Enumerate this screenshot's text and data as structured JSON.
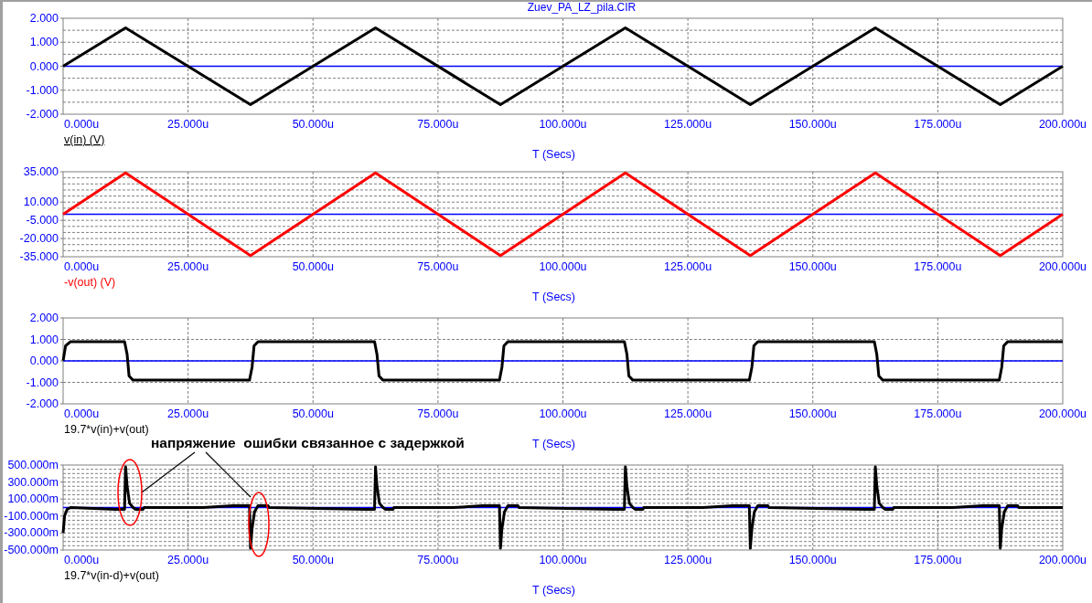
{
  "title": "Zuev_PA_LZ_pila.CIR",
  "charts": [
    {
      "legend_underlined": true,
      "chart_data": {
        "type": "line",
        "grid": true,
        "ref_lines": [
          {
            "axis": "y",
            "value": 0,
            "color": "#0000ff"
          }
        ],
        "xlabel": "T (Secs)",
        "xlim": [
          0,
          200
        ],
        "ylim": [
          -2,
          2
        ],
        "xticks": [
          {
            "value": 0,
            "label": "0.000u"
          },
          {
            "value": 25,
            "label": "25.000u"
          },
          {
            "value": 50,
            "label": "50.000u"
          },
          {
            "value": 75,
            "label": "75.000u"
          },
          {
            "value": 100,
            "label": "100.000u"
          },
          {
            "value": 125,
            "label": "125.000u"
          },
          {
            "value": 150,
            "label": "150.000u"
          },
          {
            "value": 175,
            "label": "175.000u"
          },
          {
            "value": 200,
            "label": "200.000u"
          }
        ],
        "yticks": [
          {
            "value": 2,
            "label": "2.000"
          },
          {
            "value": 1,
            "label": "1.000"
          },
          {
            "value": 0,
            "label": "0.000"
          },
          {
            "value": -1,
            "label": "-1.000"
          },
          {
            "value": -2,
            "label": "-2.000"
          }
        ],
        "x": [
          0,
          12.5,
          37.5,
          62.5,
          87.5,
          112.5,
          137.5,
          162.5,
          187.5,
          200
        ],
        "series": [
          {
            "name": "v(in) (V)",
            "color": "#000000",
            "values": [
              0,
              1.6,
              -1.6,
              1.6,
              -1.6,
              1.6,
              -1.6,
              1.6,
              -1.6,
              0
            ]
          }
        ]
      }
    },
    {
      "legend_underlined": false,
      "chart_data": {
        "type": "line",
        "grid": true,
        "ref_lines": [
          {
            "axis": "y",
            "value": 0,
            "color": "#0000ff"
          }
        ],
        "xlabel": "T (Secs)",
        "xlim": [
          0,
          200
        ],
        "ylim": [
          -35,
          35
        ],
        "xticks": [
          {
            "value": 0,
            "label": "0.000u"
          },
          {
            "value": 25,
            "label": "25.000u"
          },
          {
            "value": 50,
            "label": "50.000u"
          },
          {
            "value": 75,
            "label": "75.000u"
          },
          {
            "value": 100,
            "label": "100.000u"
          },
          {
            "value": 125,
            "label": "125.000u"
          },
          {
            "value": 150,
            "label": "150.000u"
          },
          {
            "value": 175,
            "label": "175.000u"
          },
          {
            "value": 200,
            "label": "200.000u"
          }
        ],
        "yticks": [
          {
            "value": 35,
            "label": "35.000"
          },
          {
            "value": 10,
            "label": "10.000"
          },
          {
            "value": -5,
            "label": "-5.000"
          },
          {
            "value": -20,
            "label": "-20.000"
          },
          {
            "value": -35,
            "label": "-35.000"
          }
        ],
        "x": [
          0,
          12.5,
          37.5,
          62.5,
          87.5,
          112.5,
          137.5,
          162.5,
          187.5,
          200
        ],
        "series": [
          {
            "name": "-v(out) (V)",
            "color": "#ff0000",
            "values": [
              0,
              34,
              -34,
              34,
              -34,
              34,
              -34,
              34,
              -34,
              0
            ]
          }
        ]
      }
    },
    {
      "legend_underlined": false,
      "chart_data": {
        "type": "line",
        "grid": true,
        "ref_lines": [
          {
            "axis": "y",
            "value": 0,
            "color": "#0000ff"
          }
        ],
        "xlabel": "T (Secs)",
        "xlim": [
          0,
          200
        ],
        "ylim": [
          -2,
          2
        ],
        "xticks": [
          {
            "value": 0,
            "label": "0.000u"
          },
          {
            "value": 25,
            "label": "25.000u"
          },
          {
            "value": 50,
            "label": "50.000u"
          },
          {
            "value": 75,
            "label": "75.000u"
          },
          {
            "value": 100,
            "label": "100.000u"
          },
          {
            "value": 125,
            "label": "125.000u"
          },
          {
            "value": 150,
            "label": "150.000u"
          },
          {
            "value": 175,
            "label": "175.000u"
          },
          {
            "value": 200,
            "label": "200.000u"
          }
        ],
        "yticks": [
          {
            "value": 2,
            "label": "2.000"
          },
          {
            "value": 1,
            "label": "1.000"
          },
          {
            "value": 0,
            "label": "0.000"
          },
          {
            "value": -1,
            "label": "-1.000"
          },
          {
            "value": -2,
            "label": "-2.000"
          }
        ],
        "x": [
          0,
          0.5,
          1.5,
          12.3,
          12.8,
          13.2,
          14,
          37.3,
          37.8,
          38.2,
          39,
          62.3,
          62.8,
          63.2,
          64,
          87.3,
          87.8,
          88.2,
          89,
          112.3,
          112.8,
          113.2,
          114,
          137.3,
          137.8,
          138.2,
          139,
          162.3,
          162.8,
          163.2,
          164,
          187.3,
          187.8,
          188.2,
          189,
          200
        ],
        "series": [
          {
            "name": "19.7*v(in)+v(out)",
            "color": "#000000",
            "values": [
              0,
              0.7,
              0.9,
              0.9,
              0.3,
              -0.7,
              -0.9,
              -0.9,
              -0.3,
              0.7,
              0.9,
              0.9,
              0.3,
              -0.7,
              -0.9,
              -0.9,
              -0.3,
              0.7,
              0.9,
              0.9,
              0.3,
              -0.7,
              -0.9,
              -0.9,
              -0.3,
              0.7,
              0.9,
              0.9,
              0.3,
              -0.7,
              -0.9,
              -0.9,
              -0.3,
              0.7,
              0.9,
              0.9
            ]
          }
        ]
      }
    },
    {
      "legend_underlined": false,
      "chart_data": {
        "type": "line",
        "grid": true,
        "ref_lines": [
          {
            "axis": "y",
            "value": 0,
            "color": "#0000ff"
          }
        ],
        "xlabel": "T (Secs)",
        "xlim": [
          0,
          200
        ],
        "ylim": [
          -500,
          500
        ],
        "xticks": [
          {
            "value": 0,
            "label": "0.000u"
          },
          {
            "value": 25,
            "label": "25.000u"
          },
          {
            "value": 50,
            "label": "50.000u"
          },
          {
            "value": 75,
            "label": "75.000u"
          },
          {
            "value": 100,
            "label": "100.000u"
          },
          {
            "value": 125,
            "label": "125.000u"
          },
          {
            "value": 150,
            "label": "150.000u"
          },
          {
            "value": 175,
            "label": "175.000u"
          },
          {
            "value": 200,
            "label": "200.000u"
          }
        ],
        "yticks": [
          {
            "value": 500,
            "label": "500.000m"
          },
          {
            "value": 300,
            "label": "300.000m"
          },
          {
            "value": 100,
            "label": "100.000m"
          },
          {
            "value": -100,
            "label": "-100.000m"
          },
          {
            "value": -300,
            "label": "-300.000m"
          },
          {
            "value": -500,
            "label": "-500.000m"
          }
        ],
        "annotations": [
          {
            "text": "напряжение  ошибки связанное с задержкой"
          }
        ],
        "x": [
          0,
          0.3,
          0.8,
          1.5,
          10.5,
          12.3,
          12.5,
          12.8,
          13.3,
          14,
          14.5,
          16,
          16.2,
          28,
          34,
          37.3,
          37.5,
          37.8,
          38.3,
          39,
          41,
          41.2,
          60.5,
          62.3,
          62.5,
          62.8,
          63.3,
          64,
          64.5,
          66,
          66.2,
          78,
          84,
          87.3,
          87.5,
          87.8,
          88.3,
          89,
          91,
          91.2,
          110.5,
          112.3,
          112.5,
          112.8,
          113.3,
          114,
          114.5,
          116,
          116.2,
          128,
          134,
          137.3,
          137.5,
          137.8,
          138.3,
          139,
          141,
          141.2,
          160.5,
          162.3,
          162.5,
          162.8,
          163.3,
          164,
          164.5,
          166,
          166.2,
          178,
          184,
          187.3,
          187.5,
          187.8,
          188.3,
          189,
          191,
          191.2,
          200
        ],
        "series": [
          {
            "name": "19.7*v(in-d)+v(out)",
            "color": "#000000",
            "values": [
              -300,
              -100,
              -20,
              0,
              -20,
              -20,
              480,
              250,
              50,
              0,
              -20,
              -20,
              0,
              0,
              20,
              20,
              -480,
              -250,
              -50,
              20,
              20,
              0,
              -20,
              -20,
              480,
              250,
              50,
              0,
              -20,
              -20,
              0,
              0,
              20,
              20,
              -480,
              -250,
              -50,
              20,
              20,
              0,
              -20,
              -20,
              480,
              250,
              50,
              0,
              -20,
              -20,
              0,
              0,
              20,
              20,
              -480,
              -250,
              -50,
              20,
              20,
              0,
              -20,
              -20,
              480,
              250,
              50,
              0,
              -20,
              -20,
              0,
              0,
              20,
              20,
              -480,
              -250,
              -50,
              20,
              20,
              0,
              0
            ]
          }
        ]
      }
    }
  ]
}
